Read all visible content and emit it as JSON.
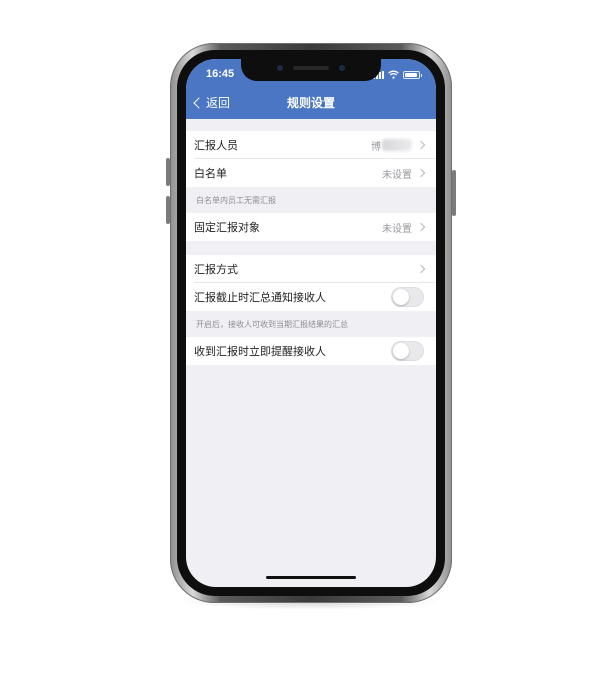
{
  "status_bar": {
    "time": "16:45",
    "icons": [
      "signal-icon",
      "wifi-icon",
      "battery-icon"
    ]
  },
  "nav": {
    "back_label": "返回",
    "title": "规则设置"
  },
  "sections": [
    {
      "rows": [
        {
          "label": "汇报人员",
          "value": "博",
          "value_blurred": true
        },
        {
          "label": "白名单",
          "value": "未设置"
        }
      ],
      "hint": "白名单内员工无需汇报"
    },
    {
      "rows": [
        {
          "label": "固定汇报对象",
          "value": "未设置"
        }
      ]
    },
    {
      "rows": [
        {
          "label": "汇报方式",
          "value": ""
        },
        {
          "label": "汇报截止时汇总通知接收人",
          "toggle": false
        }
      ],
      "hint": "开启后，接收人可收到当期汇报结果的汇总"
    },
    {
      "rows": [
        {
          "label": "收到汇报时立即提醒接收人",
          "toggle": false
        }
      ]
    }
  ],
  "colors": {
    "nav_bar": "#4a76c3",
    "background": "#efeff4",
    "toggle_off": "#e9e9eb"
  }
}
